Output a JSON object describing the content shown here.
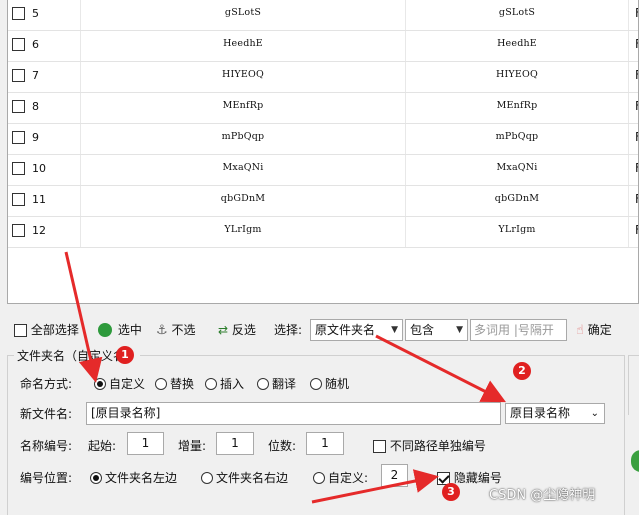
{
  "table": {
    "rows": [
      {
        "num": "5",
        "name": "gSLotS",
        "new": "gSLotS",
        "extra": "F"
      },
      {
        "num": "6",
        "name": "HeedhE",
        "new": "HeedhE",
        "extra": "F"
      },
      {
        "num": "7",
        "name": "HIYEOQ",
        "new": "HIYEOQ",
        "extra": "F"
      },
      {
        "num": "8",
        "name": "MEnfRp",
        "new": "MEnfRp",
        "extra": "F"
      },
      {
        "num": "9",
        "name": "mPbQqp",
        "new": "mPbQqp",
        "extra": "F"
      },
      {
        "num": "10",
        "name": "MxaQNi",
        "new": "MxaQNi",
        "extra": "F"
      },
      {
        "num": "11",
        "name": "qbGDnM",
        "new": "qbGDnM",
        "extra": "F"
      },
      {
        "num": "12",
        "name": "YLrIgm",
        "new": "YLrIgm",
        "extra": "F"
      }
    ]
  },
  "toolbar": {
    "select_all": "全部选择",
    "select_checked": "选中",
    "deselect": "不选",
    "invert": "反选",
    "select_label": "选择:",
    "scope_value": "原文件夹名",
    "match_value": "包含",
    "keyword_placeholder": "多词用 |号隔开",
    "confirm": "确定"
  },
  "group": {
    "title": "文件夹名（自定义名）",
    "mode_label": "命名方式:",
    "modes": [
      "自定义",
      "替换",
      "插入",
      "翻译",
      "随机"
    ],
    "selected_mode": "自定义",
    "newname_label": "新文件名:",
    "newname_value": "[原目录名称]",
    "newname_dropdown": "原目录名称",
    "numbering_label": "名称编号:",
    "start_label": "起始:",
    "start_value": "1",
    "step_label": "增量:",
    "step_value": "1",
    "digits_label": "位数:",
    "digits_value": "1",
    "separate_paths_label": "不同路径单独编号",
    "position_label": "编号位置:",
    "positions": [
      "文件夹名左边",
      "文件夹名右边",
      "自定义:"
    ],
    "custom_pos_value": "2",
    "hide_number_label": "隐藏编号"
  },
  "annotations": {
    "badge1": "1",
    "badge2": "2",
    "badge3": "3",
    "arrow_color": "#e52a2a"
  },
  "watermark": "CSDN @尘隐神明"
}
